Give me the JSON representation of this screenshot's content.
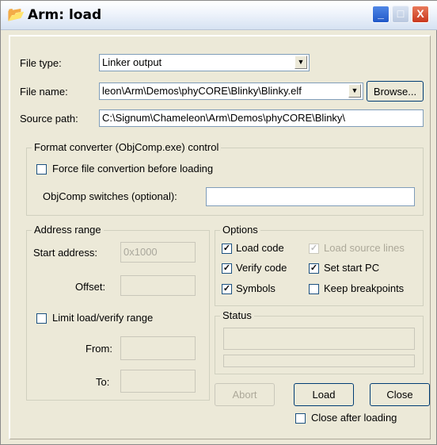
{
  "window": {
    "title": "Arm: load",
    "icon": "open-folder-icon",
    "controls": {
      "minimize": "_",
      "maximize": "□",
      "close": "X"
    }
  },
  "file_type": {
    "label": "File type:",
    "value": "Linker output"
  },
  "file_name": {
    "label": "File name:",
    "value": "leon\\Arm\\Demos\\phyCORE\\Blinky\\Blinky.elf",
    "browse_label": "Browse..."
  },
  "source_path": {
    "label": "Source path:",
    "value": "C:\\Signum\\Chameleon\\Arm\\Demos\\phyCORE\\Blinky\\"
  },
  "format_converter": {
    "title": "Format converter (ObjComp.exe) control",
    "force_label": "Force file convertion before loading",
    "force_checked": false,
    "switches_label": "ObjComp switches (optional):",
    "switches_value": ""
  },
  "address_range": {
    "title": "Address range",
    "start_label": "Start address:",
    "start_value": "0x1000",
    "offset_label": "Offset:",
    "offset_value": "",
    "limit_label": "Limit load/verify range",
    "limit_checked": false,
    "from_label": "From:",
    "from_value": "",
    "to_label": "To:",
    "to_value": ""
  },
  "options": {
    "title": "Options",
    "load_code": {
      "label": "Load code",
      "checked": true
    },
    "load_source_lines": {
      "label": "Load source lines",
      "checked": true,
      "disabled": true
    },
    "verify_code": {
      "label": "Verify code",
      "checked": true
    },
    "set_start_pc": {
      "label": "Set start PC",
      "checked": true
    },
    "symbols": {
      "label": "Symbols",
      "checked": true
    },
    "keep_breakpoints": {
      "label": "Keep breakpoints",
      "checked": false
    }
  },
  "status": {
    "title": "Status",
    "text": ""
  },
  "buttons": {
    "abort": "Abort",
    "load": "Load",
    "close": "Close"
  },
  "close_after_loading": {
    "label": "Close after loading",
    "checked": false
  },
  "colors": {
    "dialog_bg": "#ece9d8",
    "title_close": "#c9381d",
    "title_min": "#2158c8"
  }
}
